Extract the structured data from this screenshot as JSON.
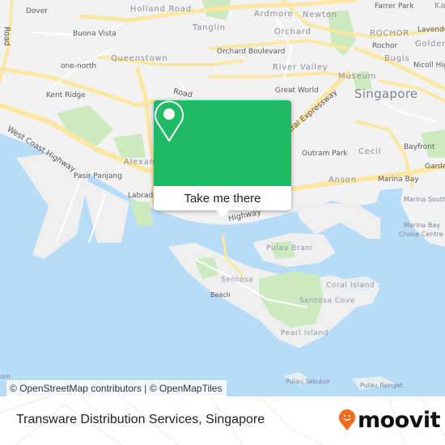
{
  "map": {
    "provider_attribution": "© OpenStreetMap contributors | © OpenMapTiles",
    "colors": {
      "water": "#b7dcf8",
      "land": "#f2f2f2",
      "park": "#cde9c0",
      "road": "#fbe7a1",
      "popup_green": "#1fba66",
      "moovit_orange": "#f26b1d"
    },
    "labels": {
      "dover": "Dover",
      "holland_road": "Holland Road",
      "ardmore": "Ardmore",
      "newton": "Newton",
      "farrer_park": "Farrer Park",
      "kallang": "Kal",
      "buona_vista": "Buona Vista",
      "tanglin": "Tanglin",
      "orchard": "Orchard",
      "rochor_district": "ROCHOR",
      "lavender": "Lavende",
      "rochor": "Rochor",
      "golden": "Golden",
      "queenstown": "Queenstown",
      "one_north": "one-north",
      "orchard_boulevard": "Orchard Boulevard",
      "river_valley": "River Valley",
      "bugis": "Bugis",
      "nicoll_highway": "Nicoll Hig",
      "museum": "Museum",
      "kent_ridge": "Kent Ridge",
      "alexandra_road": "Road",
      "great_world": "Great World",
      "singapore": "Singapore",
      "west_coast_highway": "West Coast Highway",
      "central_expressway": "tral Expressway",
      "alexandra": "Alexan",
      "outram_park": "Outram Park",
      "cecil": "Cecil",
      "bayfront": "Bayfront",
      "gardens": "Garde",
      "pasir_panjang": "Pasir Panjang",
      "anson": "Anson",
      "marina_bay": "Marina Bay",
      "labrador": "Labrado",
      "marina_south": "Marina South",
      "highway": "Highway",
      "marina_bay_cruise_centre_1": "Marina Bay",
      "marina_bay_cruise_centre_2": "Cruise Centre",
      "pulau_brani": "Pulau Brani",
      "sentosa": "Sentosa",
      "coral_island": "Coral Island",
      "beach": "Beach",
      "sentosa_cove": "Sentosa Cove",
      "pearl_island": "Pearl Island",
      "pulau_tekukor": "Pulau Tekukor",
      "pulau_renget": "Pulau Renget",
      "road_left": "Road",
      "om_fragment": "om"
    }
  },
  "popup": {
    "icon": "map-pin-icon",
    "button_label": "Take me there"
  },
  "footer": {
    "place_title": "Transware Distribution Services, Singapore",
    "logo_text": "moovit",
    "logo_icon": "moovit-smiley-pin-icon"
  }
}
